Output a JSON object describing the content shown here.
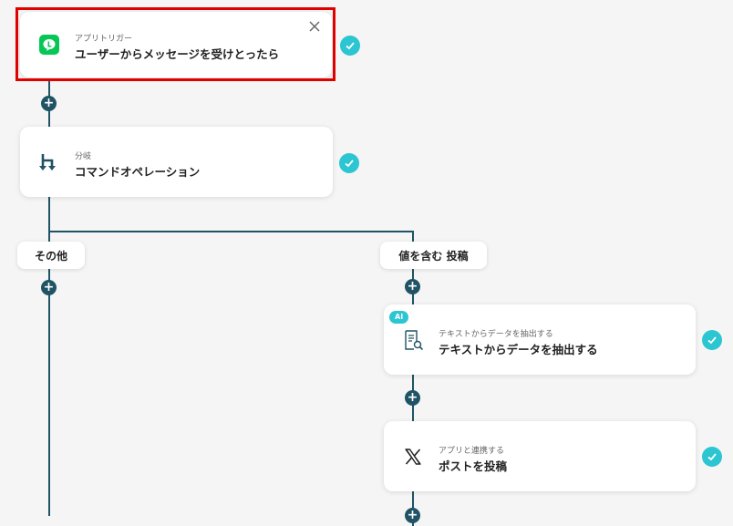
{
  "steps": {
    "trigger": {
      "small": "アプリトリガー",
      "title": "ユーザーからメッセージを受けとったら",
      "icon": "line-app-icon"
    },
    "branch": {
      "small": "分岐",
      "title": "コマンドオペレーション",
      "icon": "branch-icon"
    },
    "extract": {
      "badge": "AI",
      "small": "テキストからデータを抽出する",
      "title": "テキストからデータを抽出する",
      "icon": "document-search-icon"
    },
    "post": {
      "small": "アプリと連携する",
      "title": "ポストを投稿",
      "icon": "x-logo-icon"
    }
  },
  "branches": {
    "other": "その他",
    "contains": "値を含む 投稿"
  },
  "colors": {
    "accent": "#2cc5d2",
    "line": "#1f5365",
    "highlight": "#e00000",
    "line_app": "#06c755"
  }
}
